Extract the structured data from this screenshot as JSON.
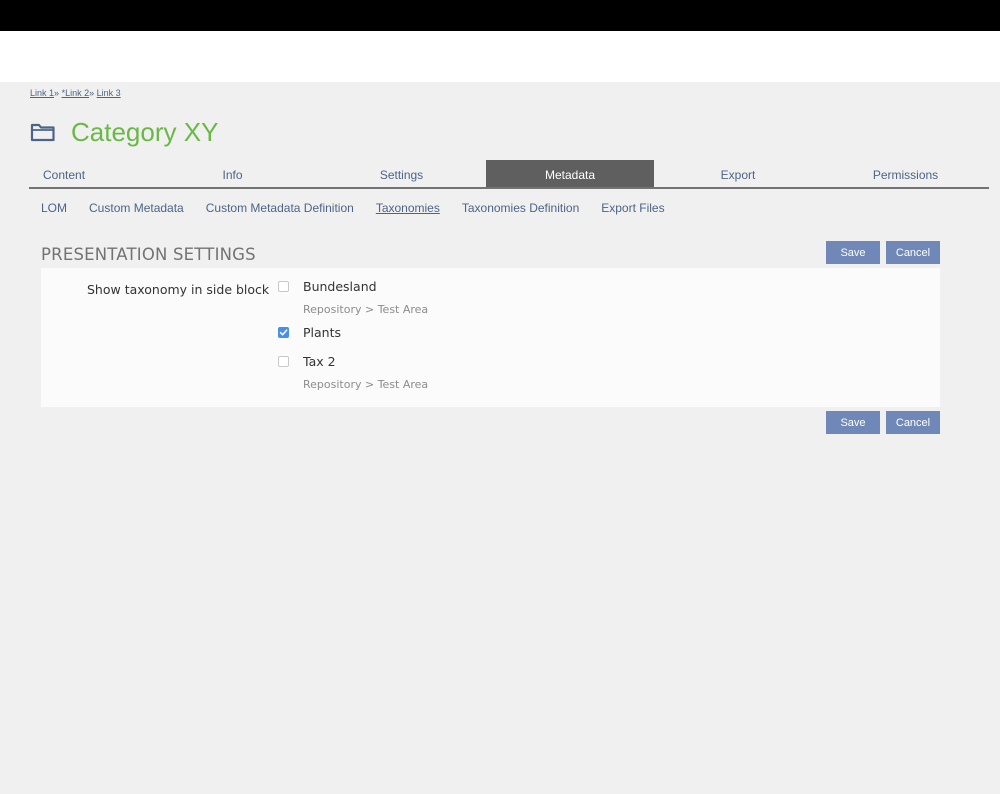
{
  "breadcrumb": {
    "items": [
      "Link 1",
      "*Link 2",
      "Link 3"
    ],
    "separator": "»"
  },
  "header": {
    "title": "Category XY",
    "icon": "folder-icon"
  },
  "tabs": [
    {
      "label": "Content",
      "active": false
    },
    {
      "label": "Info",
      "active": false
    },
    {
      "label": "Settings",
      "active": false
    },
    {
      "label": "Metadata",
      "active": true
    },
    {
      "label": "Export",
      "active": false
    },
    {
      "label": "Permissions",
      "active": false
    }
  ],
  "subtabs": [
    {
      "label": "LOM",
      "active": false
    },
    {
      "label": "Custom Metadata",
      "active": false
    },
    {
      "label": "Custom Metadata Definition",
      "active": false
    },
    {
      "label": "Taxonomies",
      "active": true
    },
    {
      "label": "Taxonomies Definition",
      "active": false
    },
    {
      "label": "Export Files",
      "active": false
    }
  ],
  "section": {
    "title": "PRESENTATION SETTINGS",
    "save_label": "Save",
    "cancel_label": "Cancel"
  },
  "form": {
    "label": "Show taxonomy in side block",
    "options": [
      {
        "label": "Bundesland",
        "checked": false,
        "path": "Repository > Test Area"
      },
      {
        "label": "Plants",
        "checked": true,
        "path": ""
      },
      {
        "label": "Tax 2",
        "checked": false,
        "path": "Repository > Test Area"
      }
    ]
  },
  "colors": {
    "title_green": "#6ab846",
    "link_blue": "#4c6586",
    "button_blue": "#6f88b7",
    "active_tab": "#5f5f5f",
    "checkbox_checked": "#4a8fe7"
  }
}
